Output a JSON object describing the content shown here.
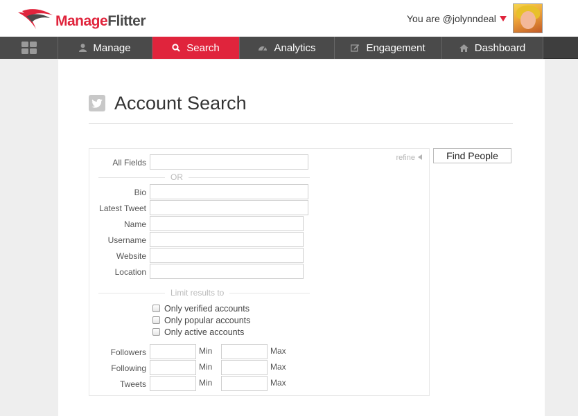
{
  "header": {
    "logo_manage": "Manage",
    "logo_flitter": "Flitter",
    "user_label": "You are @jolynndeal"
  },
  "nav": {
    "items": [
      {
        "label": "",
        "icon": "grid-icon"
      },
      {
        "label": "Manage",
        "icon": "user-icon"
      },
      {
        "label": "Search",
        "icon": "search-icon",
        "active": true
      },
      {
        "label": "Analytics",
        "icon": "gauge-icon"
      },
      {
        "label": "Engagement",
        "icon": "edit-icon"
      },
      {
        "label": "Dashboard",
        "icon": "home-icon"
      }
    ]
  },
  "page": {
    "title": "Account Search",
    "icon": "twitter-icon"
  },
  "form": {
    "refine_label": "refine",
    "all_fields_label": "All Fields",
    "or_label": "OR",
    "fields": [
      {
        "label": "Bio",
        "value": ""
      },
      {
        "label": "Latest Tweet",
        "value": ""
      },
      {
        "label": "Name",
        "value": ""
      },
      {
        "label": "Username",
        "value": ""
      },
      {
        "label": "Website",
        "value": ""
      },
      {
        "label": "Location",
        "value": ""
      }
    ],
    "limit_label": "Limit results to",
    "checkboxes": [
      {
        "label": "Only verified accounts",
        "checked": false
      },
      {
        "label": "Only popular accounts",
        "checked": false
      },
      {
        "label": "Only active accounts",
        "checked": false
      }
    ],
    "ranges": [
      {
        "label": "Followers",
        "min_label": "Min",
        "max_label": "Max"
      },
      {
        "label": "Following",
        "min_label": "Min",
        "max_label": "Max"
      },
      {
        "label": "Tweets",
        "min_label": "Min",
        "max_label": "Max"
      }
    ],
    "find_button_label": "Find People"
  },
  "colors": {
    "brand_red": "#e0243c",
    "nav_dark": "#4a4a4a"
  }
}
